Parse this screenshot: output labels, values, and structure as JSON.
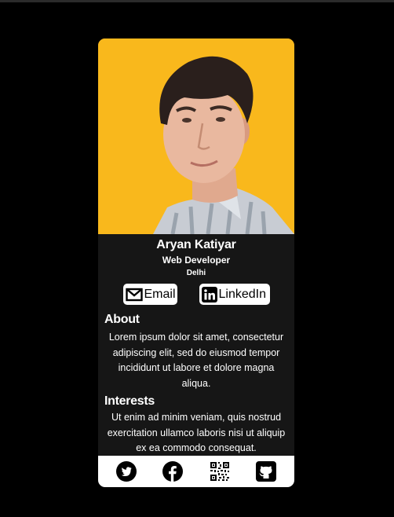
{
  "profile": {
    "name": "Aryan Katiyar",
    "role": "Web Developer",
    "location": "Delhi",
    "photo_background": "#f9b81c"
  },
  "buttons": {
    "email_label": "Email",
    "email_icon": "mail-icon",
    "linkedin_label": "LinkedIn",
    "linkedin_icon": "linkedin-icon"
  },
  "about": {
    "title": "About",
    "text": "Lorem ipsum dolor sit amet, consectetur adipiscing elit, sed do eiusmod tempor incididunt ut labore et dolore magna aliqua."
  },
  "interests": {
    "title": "Interests",
    "text": "Ut enim ad minim veniam, quis nostrud exercitation ullamco laboris nisi ut aliquip ex ea commodo consequat."
  },
  "footer": {
    "icons": [
      "twitter-icon",
      "facebook-icon",
      "qr-code-icon",
      "github-icon"
    ]
  },
  "colors": {
    "page_background": "#000000",
    "card_background": "#161616",
    "accent_yellow": "#f9b81c",
    "text": "#ffffff"
  }
}
